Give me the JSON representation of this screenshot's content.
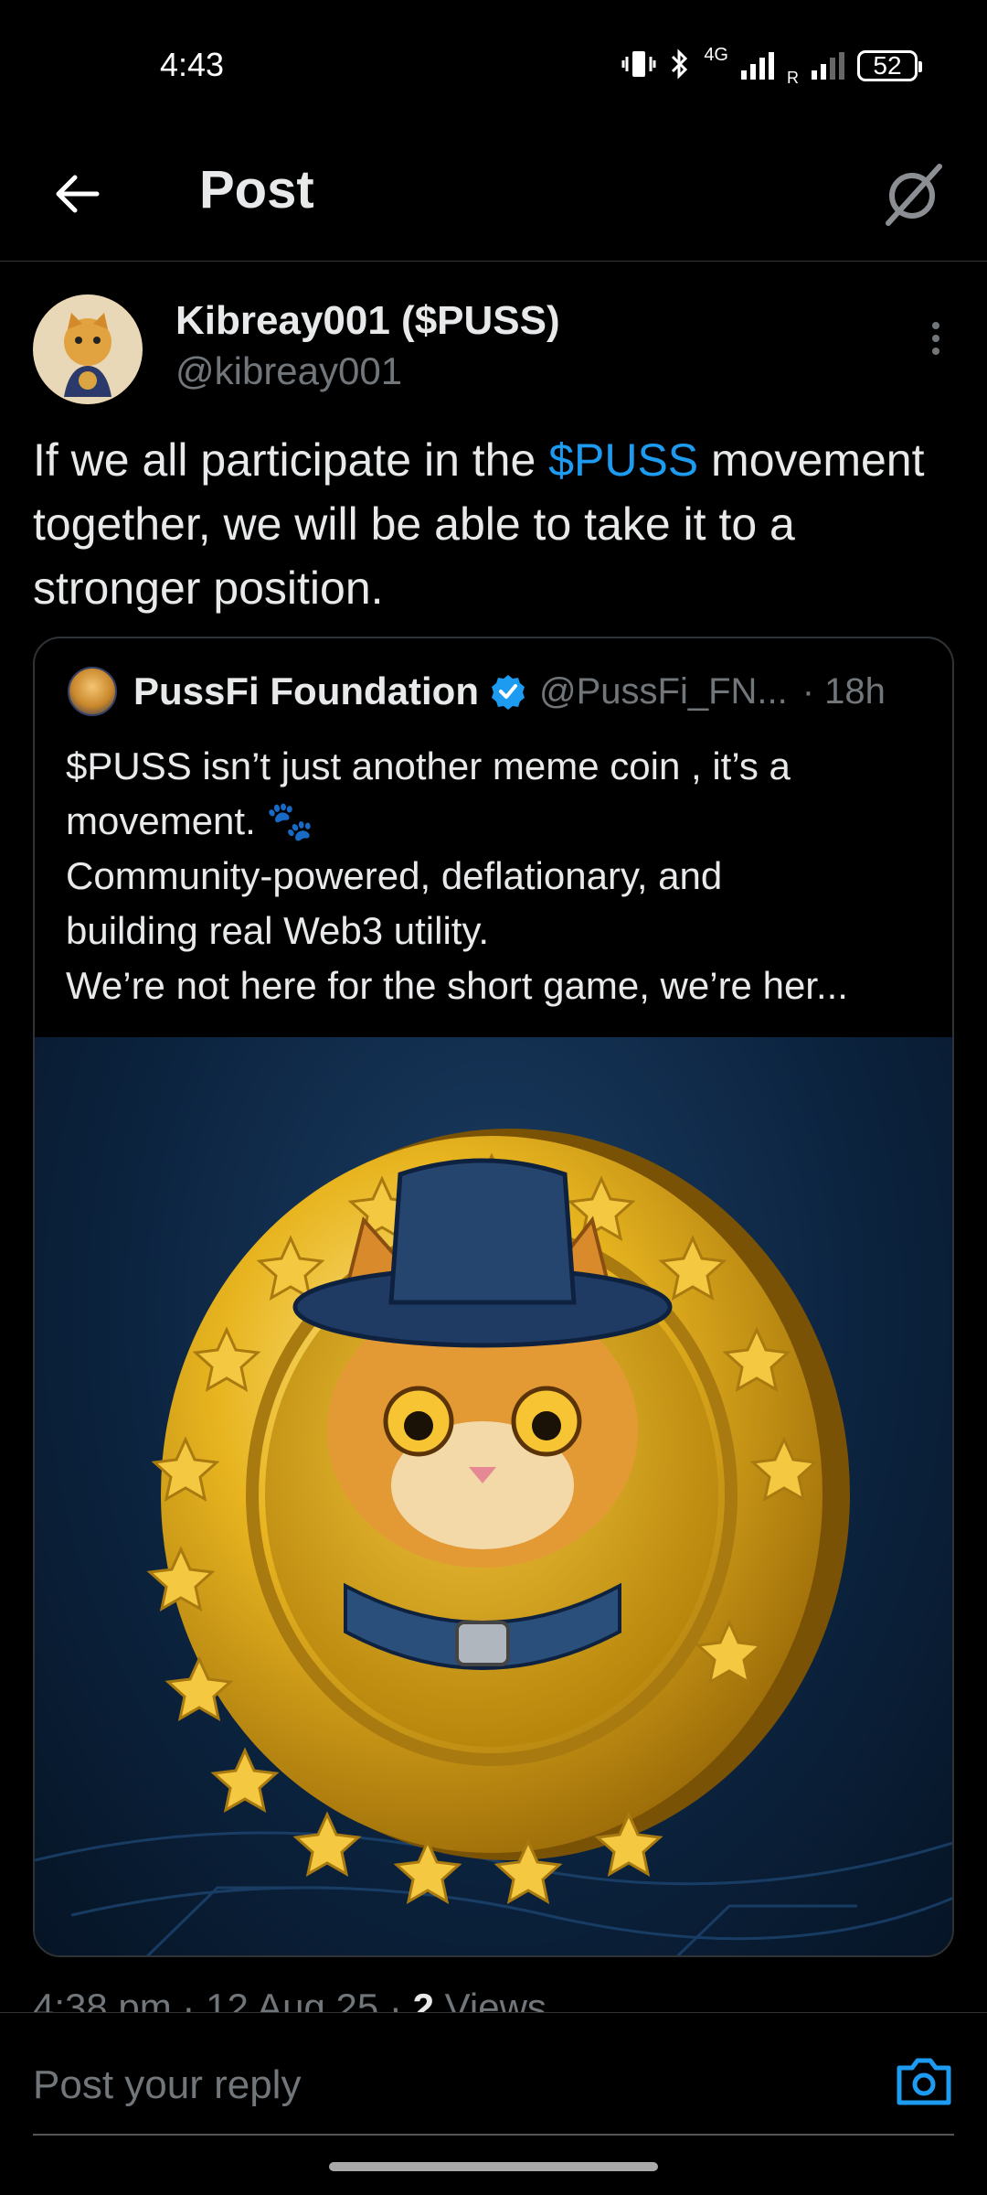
{
  "status_bar": {
    "time": "4:43",
    "network": "4G",
    "roaming": "R",
    "battery": "52"
  },
  "header": {
    "title": "Post",
    "back_icon": "arrow-left-icon",
    "grok_icon": "grok-icon"
  },
  "post": {
    "author_name": "Kibreay001 ($PUSS)",
    "author_handle": "@kibreay001",
    "text_before": "If we all participate in the ",
    "cashtag": "$PUSS",
    "text_after": " movement together, we will be able to take it to a stronger position.",
    "timestamp": "4:38 pm · 12 Aug 25 · ",
    "views_count": "2",
    "views_label": " Views"
  },
  "quote": {
    "name": "PussFi Foundation",
    "handle": "@PussFi_FN...",
    "time": "· 18h",
    "lines": [
      "$PUSS isn’t just another meme coin , it’s a",
      "movement. 🐾",
      "Community-powered, deflationary, and",
      "building real Web3 utility.",
      "We’re not here for the short game, we’re her..."
    ]
  },
  "reply": {
    "placeholder": "Post your reply"
  },
  "colors": {
    "background": "#000000",
    "accent": "#1d9bf0",
    "secondary_text": "#71767b",
    "coin_gold": "#e8b520",
    "image_bg": "#0c2440"
  }
}
